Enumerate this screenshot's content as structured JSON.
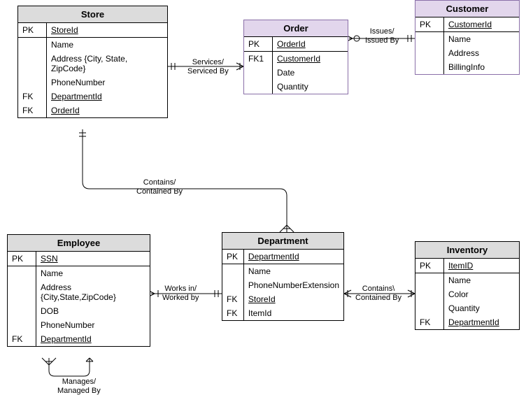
{
  "entities": {
    "store": {
      "title": "Store",
      "rows": {
        "pk_key": "PK",
        "pk_field": "StoreId",
        "name": "Name",
        "address": "Address {City, State, ZipCode}",
        "phone": "PhoneNumber",
        "fk1_key": "FK",
        "fk1_field": "DepartmentId",
        "fk2_key": "FK",
        "fk2_field": "OrderId"
      }
    },
    "order": {
      "title": "Order",
      "rows": {
        "pk_key": "PK",
        "pk_field": "OrderId",
        "fk1_key": "FK1",
        "fk1_field": "CustomerId",
        "date": "Date",
        "qty": "Quantity"
      }
    },
    "customer": {
      "title": "Customer",
      "rows": {
        "pk_key": "PK",
        "pk_field": "CustomerId",
        "name": "Name",
        "address": "Address",
        "billing": "BillingInfo"
      }
    },
    "employee": {
      "title": "Employee",
      "rows": {
        "pk_key": "PK",
        "pk_field": "SSN",
        "name": "Name",
        "address": "Address {City,State,ZipCode}",
        "dob": "DOB",
        "phone": "PhoneNumber",
        "fk1_key": "FK",
        "fk1_field": "DepartmentId"
      }
    },
    "department": {
      "title": "Department",
      "rows": {
        "pk_key": "PK",
        "pk_field": "DepartmentId",
        "name": "Name",
        "phone": "PhoneNumberExtension",
        "fk1_key": "FK",
        "fk1_field": "StoreId",
        "fk2_key": "FK",
        "fk2_field": "ItemId"
      }
    },
    "inventory": {
      "title": "Inventory",
      "rows": {
        "pk_key": "PK",
        "pk_field": "ItemID",
        "name": "Name",
        "color": "Color",
        "qty": "Quantity",
        "fk1_key": "FK",
        "fk1_field": "DepartmentId"
      }
    }
  },
  "relationships": {
    "store_order": "Services/\nServiced By",
    "order_customer": "Issues/\nIssued By",
    "store_department": "Contains/\nContained By",
    "employee_department": "Works in/\nWorked by",
    "department_inventory": "Contains\\\nContained By",
    "employee_self": "Manages/\nManaged By"
  }
}
